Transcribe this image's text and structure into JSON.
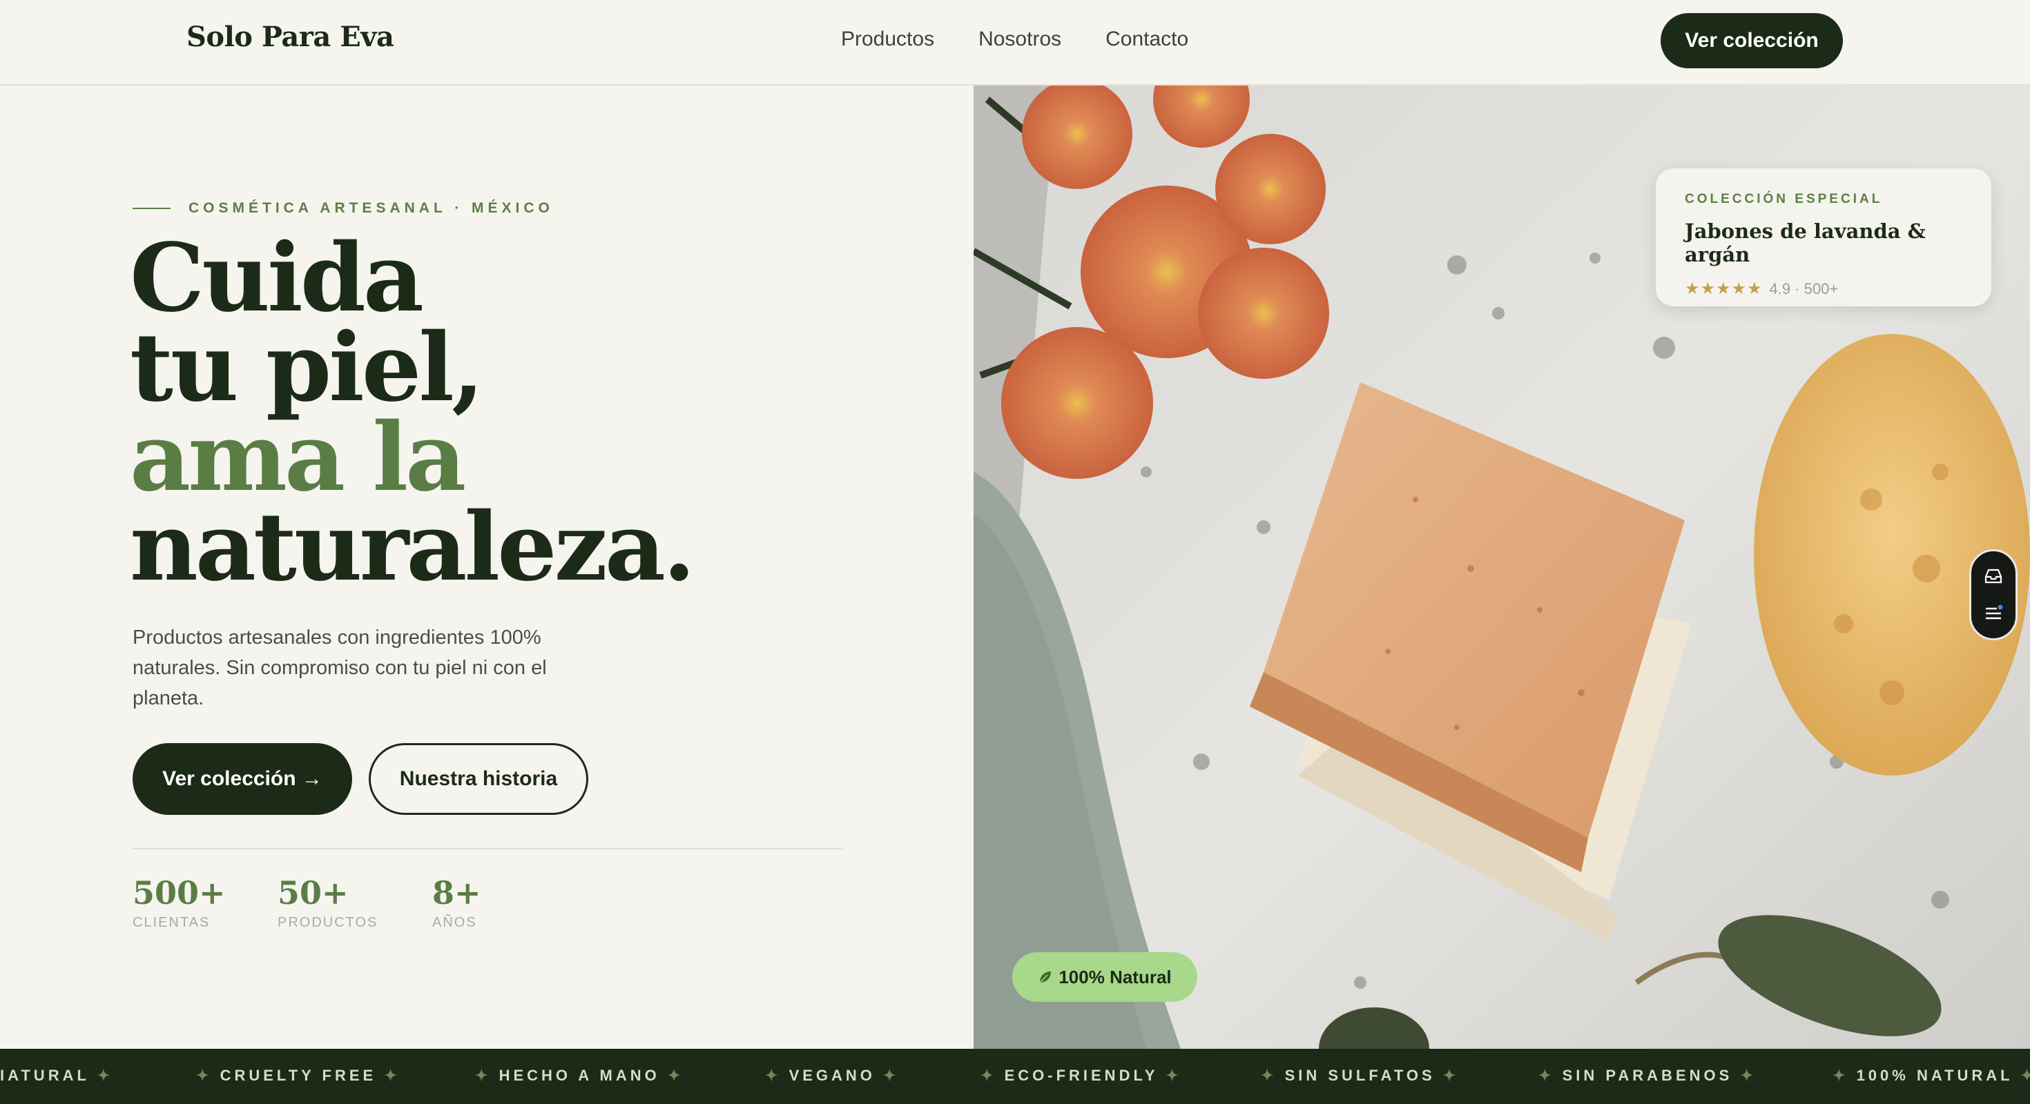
{
  "nav": {
    "logo": "Solo Para Eva",
    "links": [
      "Productos",
      "Nosotros",
      "Contacto"
    ],
    "cta": "Ver colección"
  },
  "hero": {
    "eyebrow": "COSMÉTICA ARTESANAL · MÉXICO",
    "headline_line1": "Cuida",
    "headline_line2": "tu piel,",
    "headline_line3": "ama la",
    "headline_line4": "naturaleza.",
    "description": "Productos artesanales con ingredientes 100% naturales. Sin compromiso con tu piel ni con el planeta.",
    "primary_button": "Ver colección →",
    "secondary_button": "Nuestra historia",
    "stats": [
      {
        "value": "500+",
        "label": "CLIENTAS"
      },
      {
        "value": "50+",
        "label": "PRODUCTOS"
      },
      {
        "value": "8+",
        "label": "AÑOS"
      }
    ]
  },
  "feature_card": {
    "eyebrow": "COLECCIÓN ESPECIAL",
    "title": "Jabones de lavanda & argán",
    "stars": "★★★★★",
    "rating": "4.9 · 500+"
  },
  "badge": {
    "label": "100% Natural",
    "icon": "leaf-icon"
  },
  "side_tools": {
    "icons": [
      "inbox-icon",
      "menu-icon"
    ]
  },
  "ticker": {
    "items": [
      "IATURAL",
      "CRUELTY FREE",
      "HECHO A MANO",
      "VEGANO",
      "ECO-FRIENDLY",
      "SIN SULFATOS",
      "SIN PARABENOS",
      "100% NATURAL"
    ],
    "separator": "✦"
  },
  "colors": {
    "brand_dark": "#1c2b17",
    "brand_green": "#5a7d45",
    "badge_green": "#a8d88a",
    "star_gold": "#c4a24a"
  }
}
